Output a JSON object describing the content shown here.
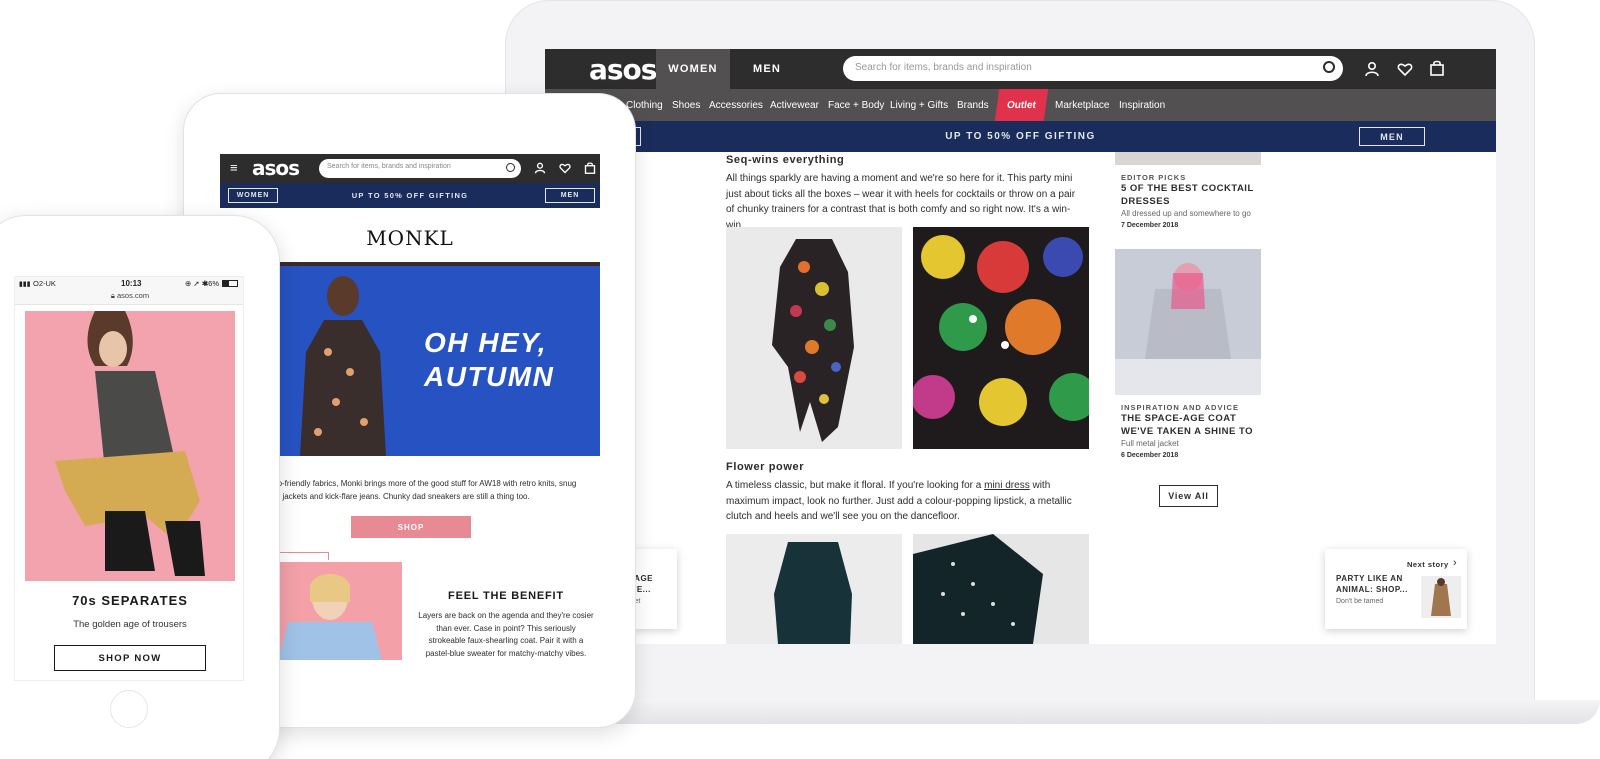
{
  "desktop": {
    "logo": "asos",
    "tabs": [
      {
        "label": "WOMEN",
        "active": true
      },
      {
        "label": "MEN",
        "active": false
      }
    ],
    "search_placeholder": "Search for items, brands and inspiration",
    "nav": [
      "Clothing",
      "Shoes",
      "Accessories",
      "Activewear",
      "Face + Body",
      "Living + Gifts",
      "Brands",
      "Outlet",
      "Marketplace",
      "Inspiration"
    ],
    "promo": {
      "text": "UP TO 50% OFF GIFTING",
      "right_button": "MEN"
    },
    "article": {
      "section1_title": "Seq-wins everything",
      "section1_body": "All things sparkly are having a moment and we're so here for it. This party mini just about ticks all the boxes – wear it with heels for cocktails or throw on a pair of chunky trainers for a contrast that is both comfy and so right now. It's a win-win.",
      "section2_title": "Flower power",
      "section2_body_before": "A timeless classic, but make it floral. If you're looking for a ",
      "section2_link": "mini dress",
      "section2_body_after": " with maximum impact, look no further. Just add a colour-popping lipstick, a metallic clutch and heels and we'll see you on the dancefloor."
    },
    "sidebar": [
      {
        "kicker": "EDITOR PICKS",
        "title": "5 OF THE BEST COCKTAIL DRESSES",
        "sub": "All dressed up and somewhere to go",
        "date": "7 December 2018"
      },
      {
        "kicker": "INSPIRATION AND ADVICE",
        "title": "THE SPACE-AGE COAT WE'VE TAKEN A SHINE TO",
        "sub": "Full metal jacket",
        "date": "6 December 2018"
      }
    ],
    "view_all": "View All",
    "prev_story_fragment": [
      "-AGE",
      "VE...",
      "ket"
    ],
    "next_story": {
      "label": "Next story",
      "title": "PARTY LIKE AN ANIMAL: SHOP...",
      "sub": "Don't be tamed"
    },
    "accent_colors": {
      "outlet": "#e0314d",
      "promo_bg": "#1a2c5b",
      "topbar": "#2d2d2d"
    }
  },
  "tablet": {
    "logo": "asos",
    "search_placeholder": "Search for items, brands and inspiration",
    "promo": {
      "left_button": "WOMEN",
      "text": "UP TO 50% OFF GIFTING",
      "right_button": "MEN"
    },
    "brand": "MONKL",
    "hero_text_line1": "OH HEY,",
    "hero_text_line2": "AUTUMN",
    "body": "on eco-friendly fabrics, Monki brings more of the good stuff for AW18 with retro knits, snug trophy jackets and kick-flare jeans. Chunky dad sneakers are still a thing too.",
    "shop_button": "SHOP",
    "feature_title": "FEEL THE BENEFIT",
    "feature_body": "Layers are back on the agenda and they're cosier than ever. Case in point? This seriously strokeable faux-shearling coat. Pair it with a pastel-blue sweater for matchy-matchy vibes."
  },
  "phone": {
    "carrier": "O2-UK",
    "time": "10:13",
    "battery": "46%",
    "url": "asos.com",
    "title": "70s SEPARATES",
    "subtitle": "The golden age of trousers",
    "cta": "SHOP NOW"
  }
}
